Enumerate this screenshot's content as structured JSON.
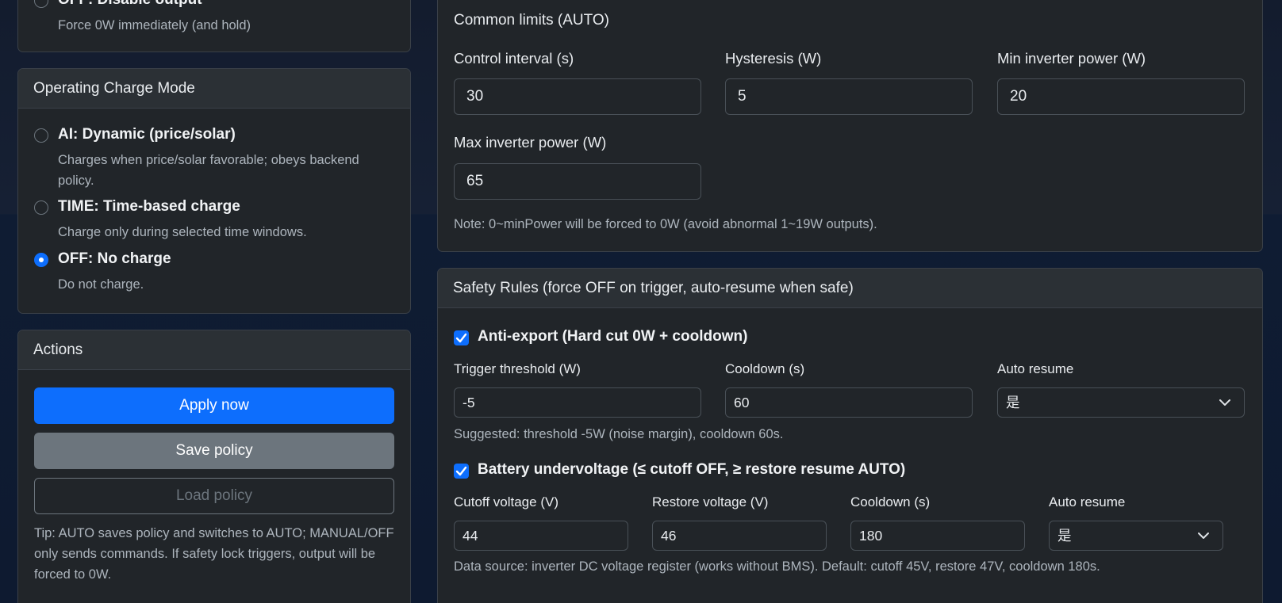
{
  "output_mode_card": {
    "partial_title": "OFF: Disable output",
    "desc": "Force 0W immediately (and hold)"
  },
  "charge_mode": {
    "header": "Operating Charge Mode",
    "options": [
      {
        "title": "AI: Dynamic (price/solar)",
        "desc": "Charges when price/solar favorable; obeys backend policy.",
        "checked": false
      },
      {
        "title": "TIME: Time-based charge",
        "desc": "Charge only during selected time windows.",
        "checked": false
      },
      {
        "title": "OFF: No charge",
        "desc": "Do not charge.",
        "checked": true
      }
    ]
  },
  "actions": {
    "header": "Actions",
    "apply_label": "Apply now",
    "save_label": "Save policy",
    "load_label": "Load policy",
    "tip": "Tip: AUTO saves policy and switches to AUTO; MANUAL/OFF only sends commands. If safety lock triggers, output will be forced to 0W."
  },
  "common_limits": {
    "title": "Common limits (AUTO)",
    "control_interval_label": "Control interval (s)",
    "control_interval_value": "30",
    "hysteresis_label": "Hysteresis (W)",
    "hysteresis_value": "5",
    "min_power_label": "Min inverter power (W)",
    "min_power_value": "20",
    "max_power_label": "Max inverter power (W)",
    "max_power_value": "65",
    "note": "Note: 0~minPower will be forced to 0W (avoid abnormal 1~19W outputs)."
  },
  "safety": {
    "header": "Safety Rules (force OFF on trigger, auto-resume when safe)",
    "anti_export": {
      "title": "Anti-export (Hard cut 0W + cooldown)",
      "checked": true,
      "threshold_label": "Trigger threshold (W)",
      "threshold_value": "-5",
      "cooldown_label": "Cooldown (s)",
      "cooldown_value": "60",
      "auto_resume_label": "Auto resume",
      "auto_resume_value": "是",
      "note": "Suggested: threshold -5W (noise margin), cooldown 60s."
    },
    "undervoltage": {
      "title": "Battery undervoltage (≤ cutoff OFF, ≥ restore resume AUTO)",
      "checked": true,
      "cutoff_label": "Cutoff voltage (V)",
      "cutoff_value": "44",
      "restore_label": "Restore voltage (V)",
      "restore_value": "46",
      "cooldown_label": "Cooldown (s)",
      "cooldown_value": "180",
      "auto_resume_label": "Auto resume",
      "auto_resume_value": "是",
      "note": "Data source: inverter DC voltage register (works without BMS). Default: cutoff 45V, restore 47V, cooldown 180s."
    }
  },
  "icons": {
    "chevron": "chevron-down-icon",
    "check": "check-icon"
  },
  "colors": {
    "accent": "#0d6efd",
    "secondary": "#6c757d",
    "card_bg": "#212529"
  }
}
